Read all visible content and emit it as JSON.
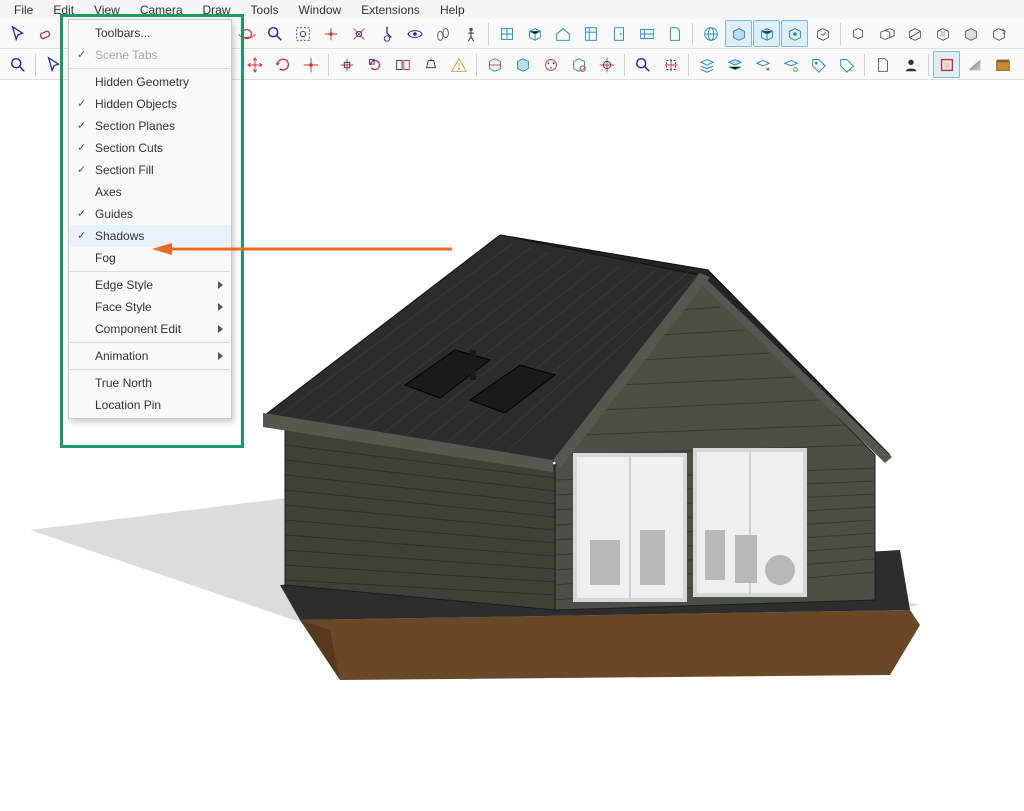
{
  "menubar": [
    "File",
    "Edit",
    "View",
    "Camera",
    "Draw",
    "Tools",
    "Window",
    "Extensions",
    "Help"
  ],
  "viewMenu": {
    "items": [
      {
        "label": "Toolbars...",
        "checked": false
      },
      {
        "label": "Scene Tabs",
        "checked": true,
        "disabled": true
      },
      {
        "sep": true
      },
      {
        "label": "Hidden Geometry",
        "checked": false
      },
      {
        "label": "Hidden Objects",
        "checked": true
      },
      {
        "label": "Section Planes",
        "checked": true
      },
      {
        "label": "Section Cuts",
        "checked": true
      },
      {
        "label": "Section Fill",
        "checked": true
      },
      {
        "label": "Axes",
        "checked": false
      },
      {
        "label": "Guides",
        "checked": true
      },
      {
        "label": "Shadows",
        "checked": true,
        "highlight": true
      },
      {
        "label": "Fog",
        "checked": false
      },
      {
        "sep": true
      },
      {
        "label": "Edge Style",
        "sub": true
      },
      {
        "label": "Face Style",
        "sub": true
      },
      {
        "label": "Component Edit",
        "sub": true
      },
      {
        "sep": true
      },
      {
        "label": "Animation",
        "sub": true
      },
      {
        "sep": true
      },
      {
        "label": "True North",
        "checked": false
      },
      {
        "label": "Location Pin",
        "checked": false
      }
    ]
  },
  "annotation": {
    "highlight_color": "#1a9968",
    "arrow_color": "#ed6a1f"
  },
  "toolbar_row1_icons": [
    "cursor-icon",
    "eraser-icon",
    "orbit-icon",
    "measure-icon",
    "text-icon",
    "zoom-extents-icon",
    "zoom-icon",
    "zoom-window-icon",
    "target-icon",
    "target2-icon",
    "position-cam-icon",
    "eye-icon",
    "walk-icon",
    "person-icon",
    "building-icon",
    "box-icon",
    "house-icon",
    "window-icon",
    "door-icon",
    "plan-icon",
    "doc-icon",
    "globe-icon",
    "component1-icon",
    "component2-icon",
    "component3-icon",
    "component4-icon",
    "solid1-icon",
    "solid2-icon",
    "solid3-icon",
    "solid4-icon",
    "solid5-icon",
    "solid6-icon"
  ],
  "toolbar_row2_icons": [
    "zoom-icon",
    "cursor-icon",
    "select-icon",
    "move-icon",
    "rotate-icon",
    "scale-icon",
    "move2-icon",
    "rotate2-icon",
    "scale2-icon",
    "flip-icon",
    "extrude-icon",
    "bend-icon",
    "section-icon",
    "section-fill-icon",
    "paint-icon",
    "inspect-icon",
    "target-icon",
    "zoom-icon",
    "zoom-selection-icon",
    "layers-icon",
    "layers2-icon",
    "layers3-icon",
    "layers4-icon",
    "tag-icon",
    "tag2-icon",
    "new-doc-icon",
    "user-icon",
    "frame-icon",
    "gradient-icon",
    "archive-icon",
    "folder-icon"
  ]
}
